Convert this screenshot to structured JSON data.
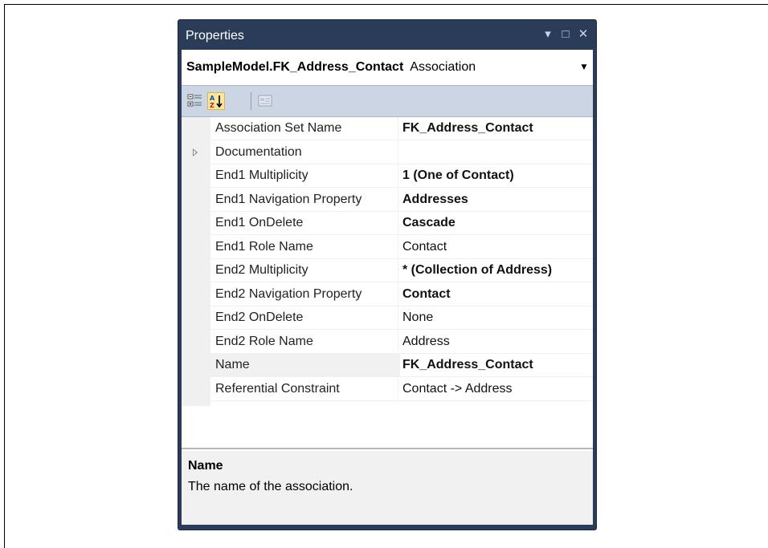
{
  "window": {
    "title": "Properties",
    "controls": {
      "dropdown_icon": "▾",
      "maximize_icon": "□",
      "close_icon": "✕"
    }
  },
  "object_selector": {
    "object_name": "SampleModel.FK_Address_Contact",
    "object_type": "Association"
  },
  "toolbar": {
    "buttons": [
      "categorized-icon",
      "alphabetical-icon",
      "property-pages-icon"
    ],
    "active": "alphabetical-icon"
  },
  "properties": [
    {
      "name": "Association Set Name",
      "value": "FK_Address_Contact",
      "bold": true
    },
    {
      "name": "Documentation",
      "value": "",
      "bold": false,
      "expandable": true
    },
    {
      "name": "End1 Multiplicity",
      "value": "1 (One of Contact)",
      "bold": true
    },
    {
      "name": "End1 Navigation Property",
      "value": "Addresses",
      "bold": true
    },
    {
      "name": "End1 OnDelete",
      "value": "Cascade",
      "bold": true
    },
    {
      "name": "End1 Role Name",
      "value": "Contact",
      "bold": false
    },
    {
      "name": "End2 Multiplicity",
      "value": "* (Collection of Address)",
      "bold": true
    },
    {
      "name": "End2 Navigation Property",
      "value": "Contact",
      "bold": true
    },
    {
      "name": "End2 OnDelete",
      "value": "None",
      "bold": false
    },
    {
      "name": "End2 Role Name",
      "value": "Address",
      "bold": false
    },
    {
      "name": "Name",
      "value": "FK_Address_Contact",
      "bold": true,
      "selected": true
    },
    {
      "name": "Referential Constraint",
      "value": "Contact -> Address",
      "bold": false
    }
  ],
  "description": {
    "title": "Name",
    "text": "The name of the association."
  },
  "colors": {
    "titlebar": "#2b3c59",
    "toolbar": "#ccd5e4",
    "active_button": "#fbe6a2"
  }
}
